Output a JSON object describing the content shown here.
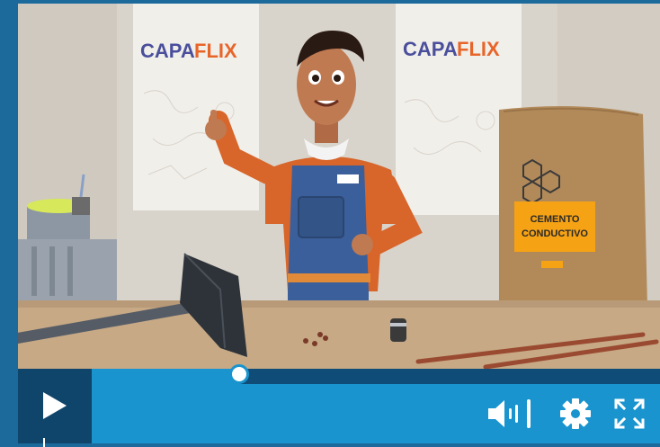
{
  "video": {
    "logo_left_a": "CAPA",
    "logo_left_b": "FLIX",
    "logo_right_a": "CAPA",
    "logo_right_b": "FLIX",
    "bag_label_line1": "CEMENTO",
    "bag_label_line2": "CONDUCTIVO",
    "colors": {
      "logo_blue": "#4a4f9c",
      "logo_orange": "#e8652a",
      "apron": "#3b5f9a",
      "shirt": "#d8652a",
      "bag": "#b28a5a",
      "label": "#f5a214"
    }
  },
  "player": {
    "progress": 0.26,
    "controls": {
      "play": "play-icon",
      "volume": "volume-icon",
      "settings": "gear-icon",
      "fullscreen": "fullscreen-icon"
    },
    "colors": {
      "bar": "#1994cf",
      "play_bg": "#10456b",
      "track": "#0f4d78"
    }
  }
}
